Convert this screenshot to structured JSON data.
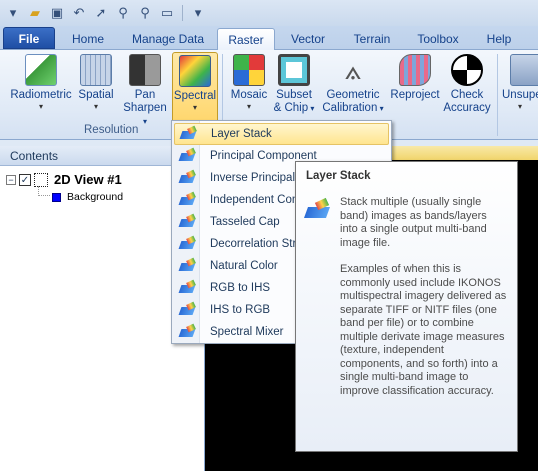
{
  "quick_access": {
    "icons": [
      "folder-open-icon",
      "save-icon",
      "undo-icon",
      "select-arrow-icon",
      "zoom-in-icon",
      "zoom-out-icon",
      "eraser-icon",
      "customize-icon"
    ]
  },
  "tabs": [
    "File",
    "Home",
    "Manage Data",
    "Raster",
    "Vector",
    "Terrain",
    "Toolbox",
    "Help"
  ],
  "ribbon": {
    "resolution_group": "Resolution",
    "buttons": {
      "radiometric": "Radiometric",
      "spatial": "Spatial",
      "pan_sharpen_1": "Pan",
      "pan_sharpen_2": "Sharpen",
      "spectral": "Spectral",
      "mosaic": "Mosaic",
      "subset_1": "Subset",
      "subset_2": "& Chip",
      "geometric_1": "Geometric",
      "geometric_2": "Calibration",
      "reproject": "Reproject",
      "check_1": "Check",
      "check_2": "Accuracy",
      "unsup": "Unsupe"
    }
  },
  "contents": {
    "header": "Contents",
    "root": "2D View #1",
    "child": "Background"
  },
  "menu": {
    "items": [
      "Layer Stack",
      "Principal Component",
      "Inverse Principal",
      "Independent Con",
      "Tasseled Cap",
      "Decorrelation Str",
      "Natural Color",
      "RGB to IHS",
      "IHS to RGB",
      "Spectral Mixer"
    ]
  },
  "tooltip": {
    "title": "Layer Stack",
    "p1": "Stack multiple (usually single band) images as bands/layers into a single output multi-band image file.",
    "p2": "Examples of when this is commonly used include IKONOS multispectral imagery delivered as separate TIFF or NITF files (one band per file) or to combine multiple derivate image measures (texture, independent components, and so forth) into a single multi-band image to improve classification accuracy."
  },
  "colors": {
    "accent_file": "#1f4fa5",
    "pressed": "#ffd66b",
    "swatch": "#0000ff"
  }
}
